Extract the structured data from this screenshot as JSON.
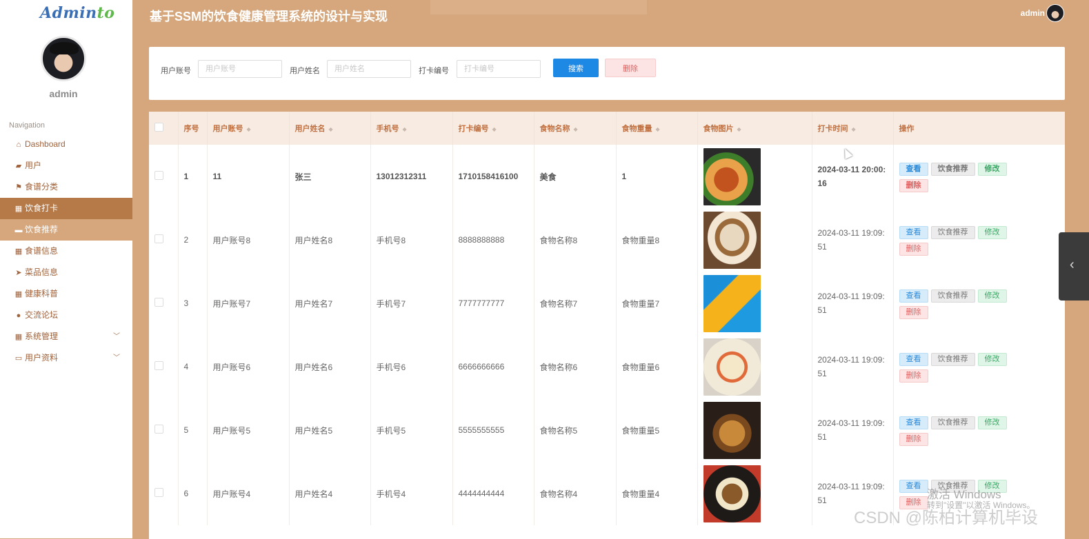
{
  "app": {
    "logo_main": "Admin",
    "logo_accent": "to",
    "title": "基于SSM的饮食健康管理系统的设计与实现",
    "user": "admin"
  },
  "sidebar": {
    "username": "admin",
    "nav_title": "Navigation",
    "items": [
      {
        "label": "Dashboard",
        "icon": "home-icon"
      },
      {
        "label": "用户",
        "icon": "thumb-icon"
      },
      {
        "label": "食谱分类",
        "icon": "flag-icon"
      },
      {
        "label": "饮食打卡",
        "icon": "grid-icon"
      },
      {
        "label": "饮食推荐",
        "icon": "comment-icon"
      },
      {
        "label": "食谱信息",
        "icon": "grid-icon"
      },
      {
        "label": "菜品信息",
        "icon": "send-icon"
      },
      {
        "label": "健康科普",
        "icon": "grid-icon"
      },
      {
        "label": "交流论坛",
        "icon": "bulb-icon"
      },
      {
        "label": "系统管理",
        "icon": "grid-icon"
      },
      {
        "label": "用户资料",
        "icon": "card-icon"
      }
    ]
  },
  "search": {
    "account_label": "用户账号",
    "account_placeholder": "用户账号",
    "name_label": "用户姓名",
    "name_placeholder": "用户姓名",
    "checkin_label": "打卡编号",
    "checkin_placeholder": "打卡编号",
    "search_button": "搜索",
    "delete_button": "删除"
  },
  "table": {
    "headers": [
      "序号",
      "用户账号",
      "用户姓名",
      "手机号",
      "打卡编号",
      "食物名称",
      "食物重量",
      "食物图片",
      "打卡时间",
      "操作"
    ],
    "rows": [
      {
        "no": "1",
        "account": "11",
        "name": "张三",
        "phone": "13012312311",
        "checkin": "1710158416100",
        "food": "美食",
        "weight": "1",
        "time": "2024-03-11 20:00:16"
      },
      {
        "no": "2",
        "account": "用户账号8",
        "name": "用户姓名8",
        "phone": "手机号8",
        "checkin": "8888888888",
        "food": "食物名称8",
        "weight": "食物重量8",
        "time": "2024-03-11 19:09:51"
      },
      {
        "no": "3",
        "account": "用户账号7",
        "name": "用户姓名7",
        "phone": "手机号7",
        "checkin": "7777777777",
        "food": "食物名称7",
        "weight": "食物重量7",
        "time": "2024-03-11 19:09:51"
      },
      {
        "no": "4",
        "account": "用户账号6",
        "name": "用户姓名6",
        "phone": "手机号6",
        "checkin": "6666666666",
        "food": "食物名称6",
        "weight": "食物重量6",
        "time": "2024-03-11 19:09:51"
      },
      {
        "no": "5",
        "account": "用户账号5",
        "name": "用户姓名5",
        "phone": "手机号5",
        "checkin": "5555555555",
        "food": "食物名称5",
        "weight": "食物重量5",
        "time": "2024-03-11 19:09:51"
      },
      {
        "no": "6",
        "account": "用户账号4",
        "name": "用户姓名4",
        "phone": "手机号4",
        "checkin": "4444444444",
        "food": "食物名称4",
        "weight": "食物重量4",
        "time": "2024-03-11 19:09:51"
      }
    ],
    "ops": {
      "view": "查看",
      "recommend": "饮食推荐",
      "edit": "修改",
      "delete": "删除"
    }
  },
  "overlay": {
    "activate_line1": "激活 Windows",
    "activate_line2": "转到\"设置\"以激活 Windows。",
    "csdn": "CSDN @陈柏计算机毕设"
  },
  "colors": {
    "accent": "#d6a77c",
    "active_nav": "#b57a48",
    "search_button": "#1e88e5"
  }
}
